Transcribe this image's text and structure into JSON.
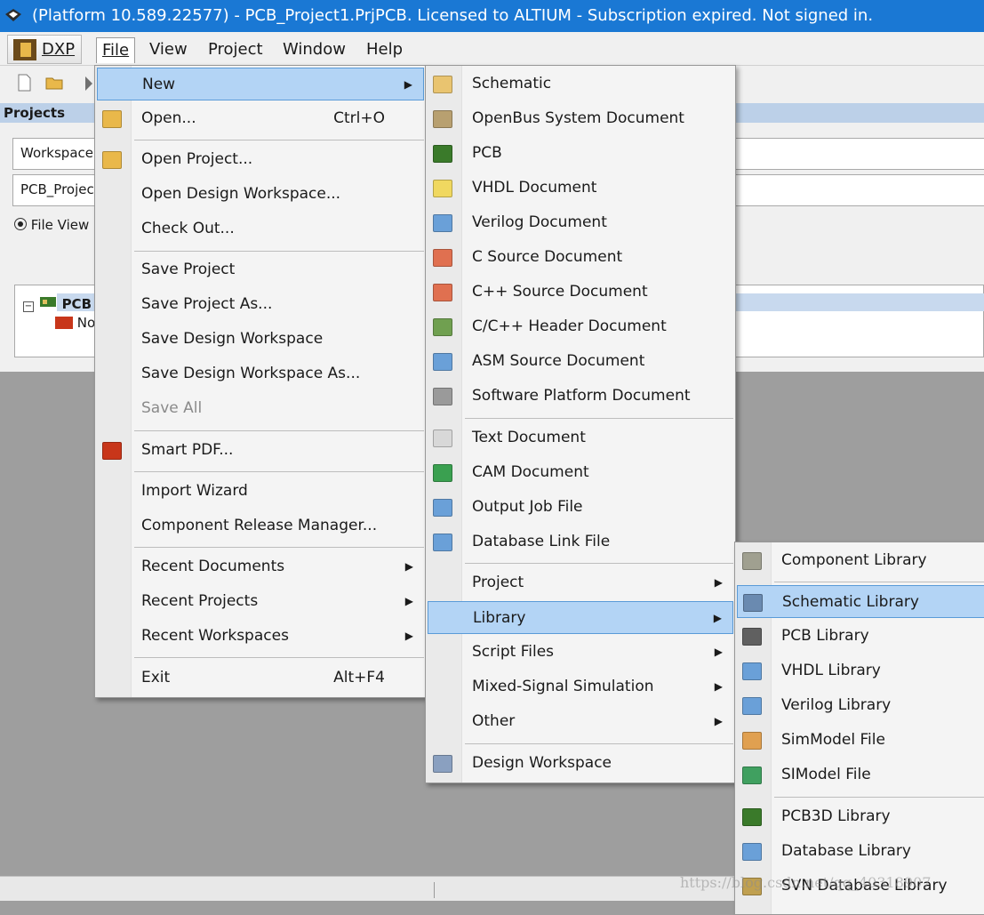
{
  "window": {
    "title": "(Platform 10.589.22577) - PCB_Project1.PrjPCB. Licensed to ALTIUM - Subscription expired. Not signed in."
  },
  "menubar": {
    "dxp": "DXP",
    "file": "File",
    "view": "View",
    "project": "Project",
    "window": "Window",
    "help": "Help"
  },
  "projects": {
    "header": "Projects",
    "workspace_field": "Workspace",
    "project_field": "PCB_Projec",
    "file_view_radio": "File View",
    "tree_root": "PCB",
    "tree_child": "No"
  },
  "file_menu": {
    "items": [
      {
        "label": "New",
        "shortcut": "",
        "submenu": true
      },
      {
        "label": "Open...",
        "shortcut": "Ctrl+O",
        "submenu": false
      },
      {
        "label": "Open Project...",
        "shortcut": "",
        "submenu": false
      },
      {
        "label": "Open Design Workspace...",
        "shortcut": "",
        "submenu": false
      },
      {
        "label": "Check Out...",
        "shortcut": "",
        "submenu": false
      },
      {
        "label": "Save Project",
        "shortcut": "",
        "submenu": false
      },
      {
        "label": "Save Project As...",
        "shortcut": "",
        "submenu": false
      },
      {
        "label": "Save Design Workspace",
        "shortcut": "",
        "submenu": false
      },
      {
        "label": "Save Design Workspace As...",
        "shortcut": "",
        "submenu": false
      },
      {
        "label": "Save All",
        "shortcut": "",
        "submenu": false,
        "disabled": true
      },
      {
        "label": "Smart PDF...",
        "shortcut": "",
        "submenu": false
      },
      {
        "label": "Import Wizard",
        "shortcut": "",
        "submenu": false
      },
      {
        "label": "Component Release Manager...",
        "shortcut": "",
        "submenu": false
      },
      {
        "label": "Recent Documents",
        "shortcut": "",
        "submenu": true
      },
      {
        "label": "Recent Projects",
        "shortcut": "",
        "submenu": true
      },
      {
        "label": "Recent Workspaces",
        "shortcut": "",
        "submenu": true
      },
      {
        "label": "Exit",
        "shortcut": "Alt+F4",
        "submenu": false
      }
    ]
  },
  "new_menu": {
    "items": [
      {
        "label": "Schematic",
        "icon": "schematic-icon"
      },
      {
        "label": "OpenBus System Document",
        "icon": "openbus-icon"
      },
      {
        "label": "PCB",
        "icon": "pcb-icon"
      },
      {
        "label": "VHDL Document",
        "icon": "vhdl-icon"
      },
      {
        "label": "Verilog Document",
        "icon": "verilog-icon"
      },
      {
        "label": "C Source Document",
        "icon": "c-source-icon"
      },
      {
        "label": "C++ Source Document",
        "icon": "cpp-source-icon"
      },
      {
        "label": "C/C++ Header Document",
        "icon": "header-icon"
      },
      {
        "label": "ASM Source Document",
        "icon": "asm-icon"
      },
      {
        "label": "Software Platform Document",
        "icon": "software-platform-icon"
      },
      {
        "label": "Text Document",
        "icon": "text-document-icon"
      },
      {
        "label": "CAM Document",
        "icon": "cam-icon"
      },
      {
        "label": "Output Job File",
        "icon": "output-job-icon"
      },
      {
        "label": "Database Link File",
        "icon": "database-link-icon"
      },
      {
        "label": "Project",
        "icon": ""
      },
      {
        "label": "Library",
        "icon": ""
      },
      {
        "label": "Script Files",
        "icon": ""
      },
      {
        "label": "Mixed-Signal Simulation",
        "icon": ""
      },
      {
        "label": "Other",
        "icon": ""
      },
      {
        "label": "Design Workspace",
        "icon": "design-workspace-icon"
      }
    ]
  },
  "library_menu": {
    "items": [
      {
        "label": "Component Library",
        "icon": "component-library-icon"
      },
      {
        "label": "Schematic Library",
        "icon": "schematic-library-icon"
      },
      {
        "label": "PCB Library",
        "icon": "pcb-library-icon"
      },
      {
        "label": "VHDL Library",
        "icon": "vhdl-library-icon"
      },
      {
        "label": "Verilog Library",
        "icon": "verilog-library-icon"
      },
      {
        "label": "SimModel File",
        "icon": "simmodel-icon"
      },
      {
        "label": "SIModel File",
        "icon": "simodel-icon"
      },
      {
        "label": "PCB3D Library",
        "icon": "pcb3d-library-icon"
      },
      {
        "label": "Database Library",
        "icon": "database-library-icon"
      },
      {
        "label": "SVN Database Library",
        "icon": "svn-database-library-icon"
      }
    ]
  },
  "watermark": "https://blog.csdn.net/qq_40318907",
  "colors": {
    "titlebar": "#1a78d4",
    "highlight": "#b3d4f5",
    "highlight_border": "#5a9bd8"
  }
}
